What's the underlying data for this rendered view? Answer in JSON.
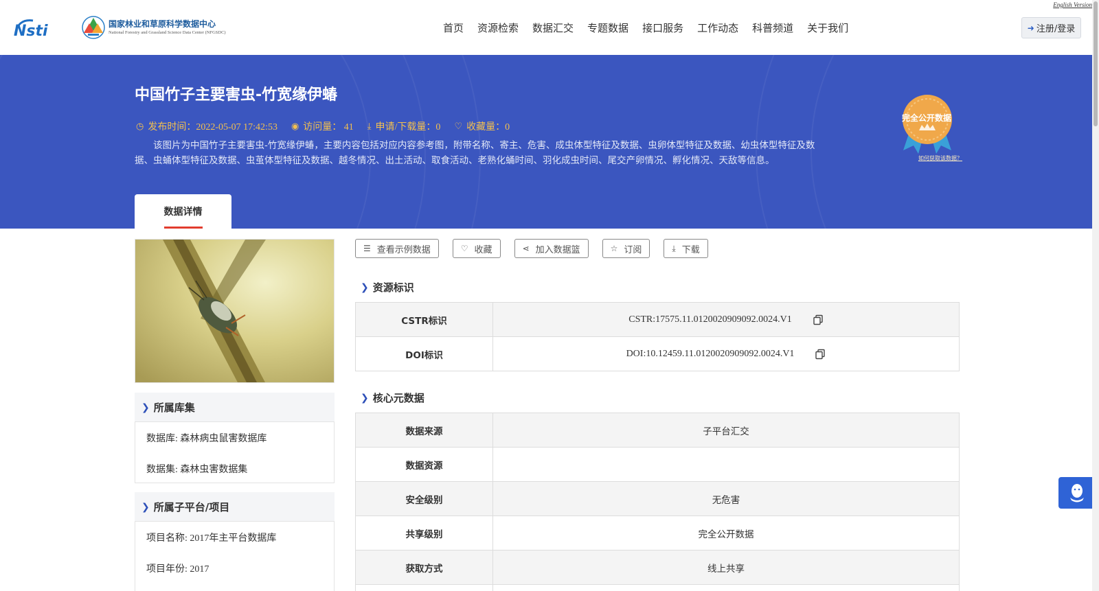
{
  "header": {
    "logo_nsti_text": "NSTI",
    "logo_cn": "国家林业和草原科学数据中心",
    "logo_en": "National Forestry and Grassland Science Data Center (NFGSDC)",
    "english_version": "English Version",
    "nav": [
      "首页",
      "资源检索",
      "数据汇交",
      "专题数据",
      "接口服务",
      "工作动态",
      "科普频道",
      "关于我们"
    ],
    "login_label": "注册/登录"
  },
  "banner": {
    "title": "中国竹子主要害虫-竹宽缘伊蝽",
    "publish_time": "发布时间：2022-05-07 17:42:53",
    "views": "访问量： 41",
    "downloads": "申请/下载量：0",
    "favorites": "收藏量：0",
    "description": "该图片为中国竹子主要害虫-竹宽缘伊蝽，主要内容包括对应内容参考图，附带名称、寄主、危害、成虫体型特征及数据、虫卵体型特征及数据、幼虫体型特征及数据、虫蛹体型特征及数据、虫茧体型特征及数据、越冬情况、出土活动、取食活动、老熟化蛹时间、羽化成虫时间、尾交产卵情况、孵化情况、天敌等信息。",
    "badge_text": "完全公开数据",
    "badge_link": "如何获取该数据？",
    "tab_label": "数据详情"
  },
  "left": {
    "collection_title": "所属库集",
    "database": "数据库: 森林病虫鼠害数据库",
    "dataset": "数据集: 森林虫害数据集",
    "platform_title": "所属子平台/项目",
    "project_name": "项目名称: 2017年主平台数据库",
    "project_year": "项目年份: 2017"
  },
  "actions": [
    "查看示例数据",
    "收藏",
    "加入数据篮",
    "订阅",
    "下载"
  ],
  "resource_id": {
    "title": "资源标识",
    "rows": [
      {
        "label": "CSTR标识",
        "value": "CSTR:17575.11.0120020909092.0024.V1"
      },
      {
        "label": "DOI标识",
        "value": "DOI:10.12459.11.0120020909092.0024.V1"
      }
    ]
  },
  "core_meta": {
    "title": "核心元数据",
    "rows": [
      {
        "label": "数据来源",
        "value": "子平台汇交"
      },
      {
        "label": "数据资源",
        "value": ""
      },
      {
        "label": "安全级别",
        "value": "无危害"
      },
      {
        "label": "共享级别",
        "value": "完全公开数据"
      },
      {
        "label": "获取方式",
        "value": "线上共享"
      }
    ]
  },
  "colors": {
    "banner": "#3b56bf",
    "meta_gold": "#f3c04f",
    "accent_red": "#e23c2e",
    "float_blue": "#2f63d6"
  },
  "icons": {
    "publish": "clock-icon",
    "views": "eye-icon",
    "downloads": "download-icon",
    "favorites": "heart-icon",
    "login": "sign-in-icon",
    "example": "database-icon",
    "favorite": "heart-icon",
    "basket": "share-icon",
    "subscribe": "star-icon",
    "download": "download-icon",
    "copy": "copy-icon",
    "float": "qq-icon"
  }
}
